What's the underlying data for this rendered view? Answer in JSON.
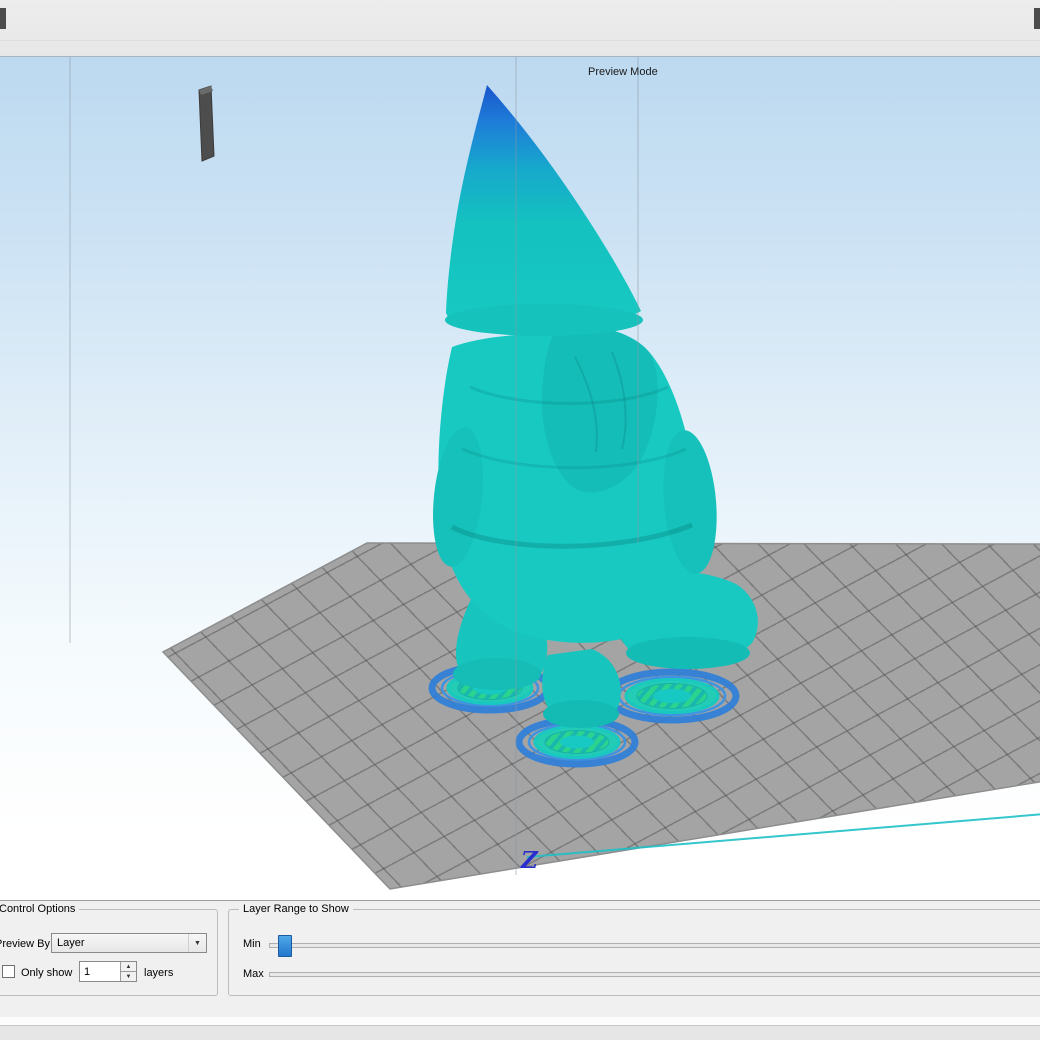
{
  "viewport": {
    "mode_label": "Preview Mode",
    "z_axis_label": "Z"
  },
  "panel": {
    "control_options": {
      "title": "Control Options",
      "preview_by_label": "Preview By",
      "preview_by_value": "Layer",
      "only_show_label": "Only show",
      "only_show_value": "1",
      "only_show_checked": false,
      "layers_label": "layers"
    },
    "layer_range": {
      "title": "Layer Range to Show",
      "min_label": "Min",
      "max_label": "Max"
    }
  },
  "icons": {
    "dropdown_arrow": "▼",
    "spin_up": "▲",
    "spin_down": "▼"
  },
  "colors": {
    "slider_handle_blue": "#2e86d8",
    "model_teal": "#18c9c2",
    "hat_blue": "#1b55cc",
    "raft_ring_blue": "#2e7fd8",
    "raft_green": "#2bd48e",
    "platform_gray": "#a4a4a4"
  }
}
